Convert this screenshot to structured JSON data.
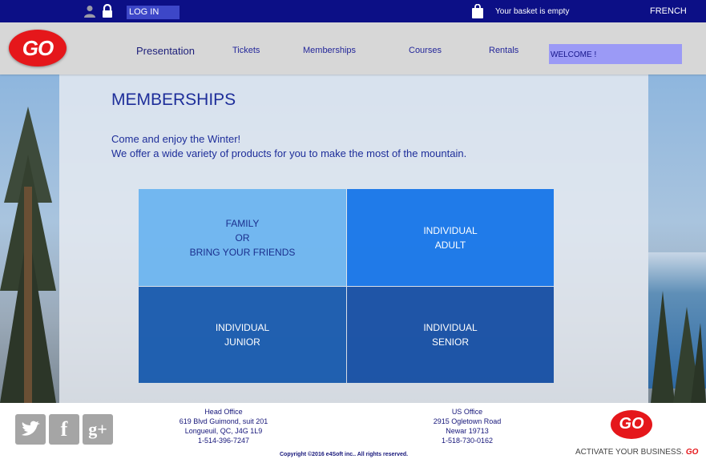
{
  "topbar": {
    "login_label": "LOG IN",
    "basket_text": "Your basket is empty",
    "language_label": "FRENCH"
  },
  "logo": {
    "text": "GO"
  },
  "nav": {
    "items": [
      "Presentation",
      "Tickets",
      "Memberships",
      "Courses",
      "Rentals"
    ],
    "active": "Presentation",
    "welcome": "WELCOME !"
  },
  "page": {
    "title": "MEMBERSHIPS",
    "intro_line1": "Come and enjoy the Winter!",
    "intro_line2": "We offer a wide variety of products for you to make the most of the mountain."
  },
  "tiles": {
    "family": [
      "FAMILY",
      "OR",
      "BRING YOUR FRIENDS"
    ],
    "adult": [
      "INDIVIDUAL",
      "ADULT"
    ],
    "junior": [
      "INDIVIDUAL",
      "JUNIOR"
    ],
    "senior": [
      "INDIVIDUAL",
      "SENIOR"
    ]
  },
  "footer": {
    "social": [
      "twitter-icon",
      "facebook-icon",
      "google-plus-icon"
    ],
    "head_office": {
      "title": "Head Office",
      "line1": "619 Blvd Guimond, suit 201",
      "line2": "Longueuil, QC, J4G 1L9",
      "phone": "1-514-396-7247"
    },
    "us_office": {
      "title": "US Office",
      "line1": "2915 Ogletown Road",
      "line2": "Newar 19713",
      "phone": "1-518-730-0162"
    },
    "copyright": "Copyright ©2016 e4Soft inc.. All rights reserved.",
    "logo_text": "GO",
    "tagline": "ACTIVATE YOUR BUSINESS.",
    "tagline_brand": "GO"
  },
  "colors": {
    "topbar": "#0c0f86",
    "brand_red": "#e5171b",
    "heading_blue": "#1e2e9a",
    "welcome_bg": "#9b9af6"
  }
}
